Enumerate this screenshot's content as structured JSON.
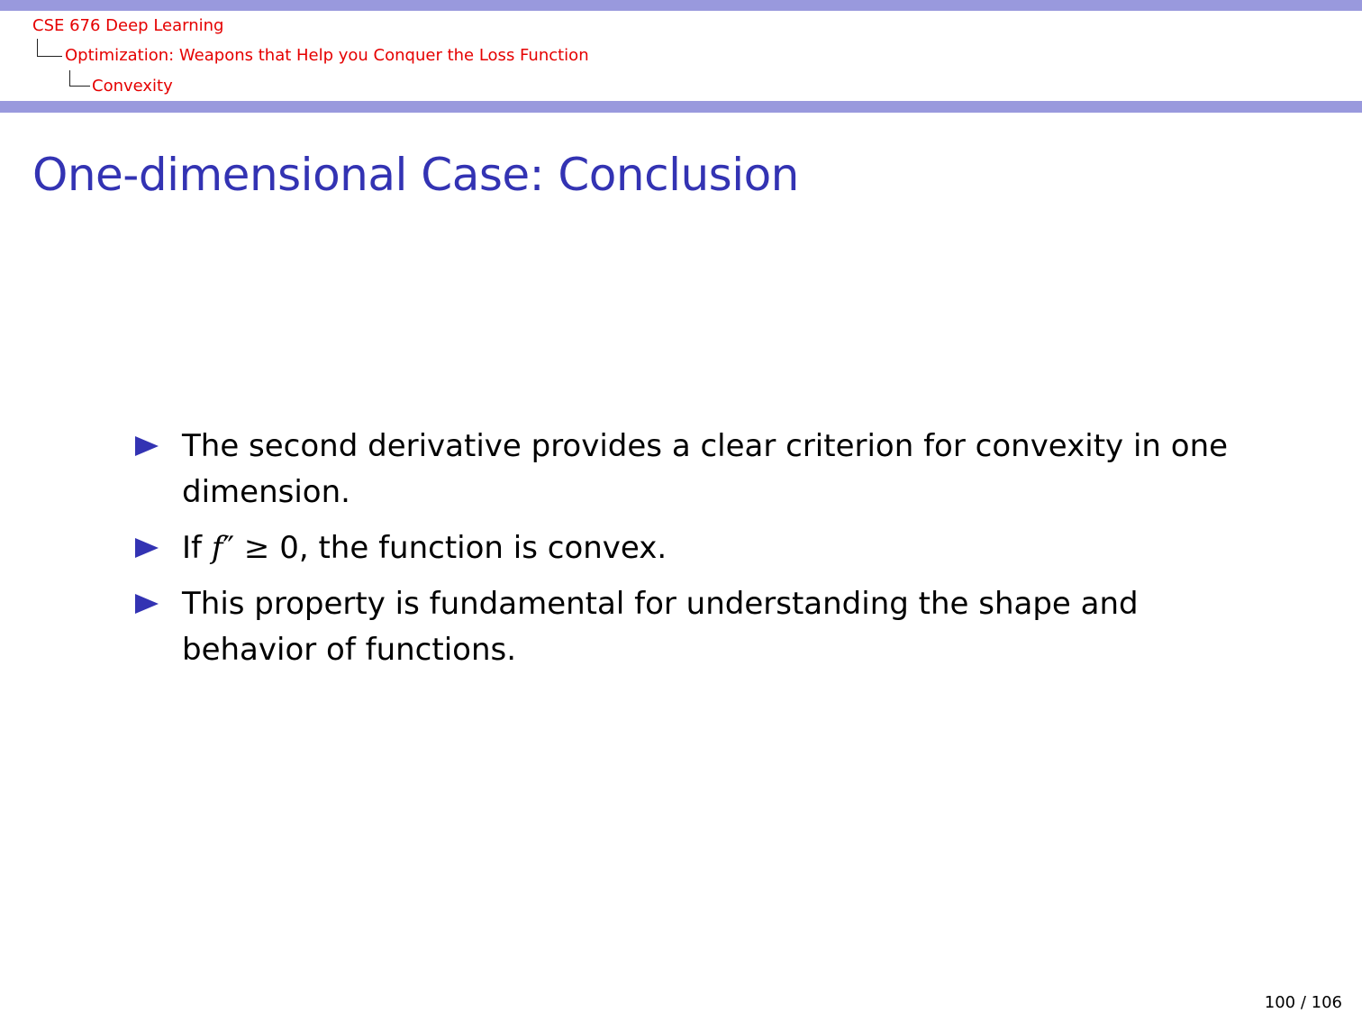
{
  "header": {
    "breadcrumb": [
      {
        "label": "CSE 676 Deep Learning"
      },
      {
        "label": "Optimization: Weapons that Help you Conquer the Loss Function"
      },
      {
        "label": "Convexity"
      }
    ],
    "colors": {
      "bar": "#9999dd",
      "breadcrumb_text": "#e50000"
    }
  },
  "slide": {
    "title": "One-dimensional Case: Conclusion",
    "title_color": "#3333b3",
    "bullets": [
      {
        "text": "The second derivative provides a clear criterion for convexity in one dimension."
      },
      {
        "prefix": "If ",
        "math_symbol": "f",
        "math_superscript": "″",
        "math_relation": " ≥ ",
        "math_value": "0",
        "suffix": ", the function is convex."
      },
      {
        "text": "This property is fundamental for understanding the shape and behavior of functions."
      }
    ],
    "bullet_marker_icon": "triangle-right-icon",
    "bullet_color": "#3333b3"
  },
  "footer": {
    "page_number": "100 / 106"
  }
}
